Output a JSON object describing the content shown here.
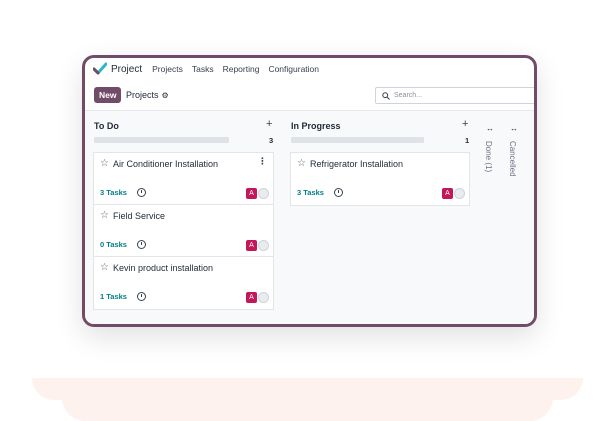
{
  "topnav": {
    "app_title": "Project",
    "items": [
      "Projects",
      "Tasks",
      "Reporting",
      "Configuration"
    ]
  },
  "controls": {
    "new_label": "New",
    "breadcrumb": "Projects",
    "search_placeholder": "Search..."
  },
  "columns": [
    {
      "title": "To Do",
      "count": "3",
      "cards": [
        {
          "title": "Air Conditioner Installation",
          "tasks": "3 Tasks",
          "avatar": "A"
        },
        {
          "title": "Field Service",
          "tasks": "0 Tasks",
          "avatar": "A"
        },
        {
          "title": "Kevin product installation",
          "tasks": "1 Tasks",
          "avatar": "A"
        }
      ]
    },
    {
      "title": "In Progress",
      "count": "1",
      "cards": [
        {
          "title": "Refrigerator Installation",
          "tasks": "3 Tasks",
          "avatar": "A"
        }
      ]
    }
  ],
  "folded_columns": [
    "Done (1)",
    "Cancelled"
  ],
  "colors": {
    "brand": "#714b67",
    "accent": "#017e84",
    "avatar": "#c2185b",
    "pedestal": "#fdf2ee"
  },
  "icons": {
    "logo": "checkmark-logo-icon",
    "gear": "gear-icon",
    "search": "search-icon",
    "star": "star-icon",
    "clock": "clock-icon",
    "add": "plus-icon",
    "unfold": "unfold-arrows-icon"
  }
}
